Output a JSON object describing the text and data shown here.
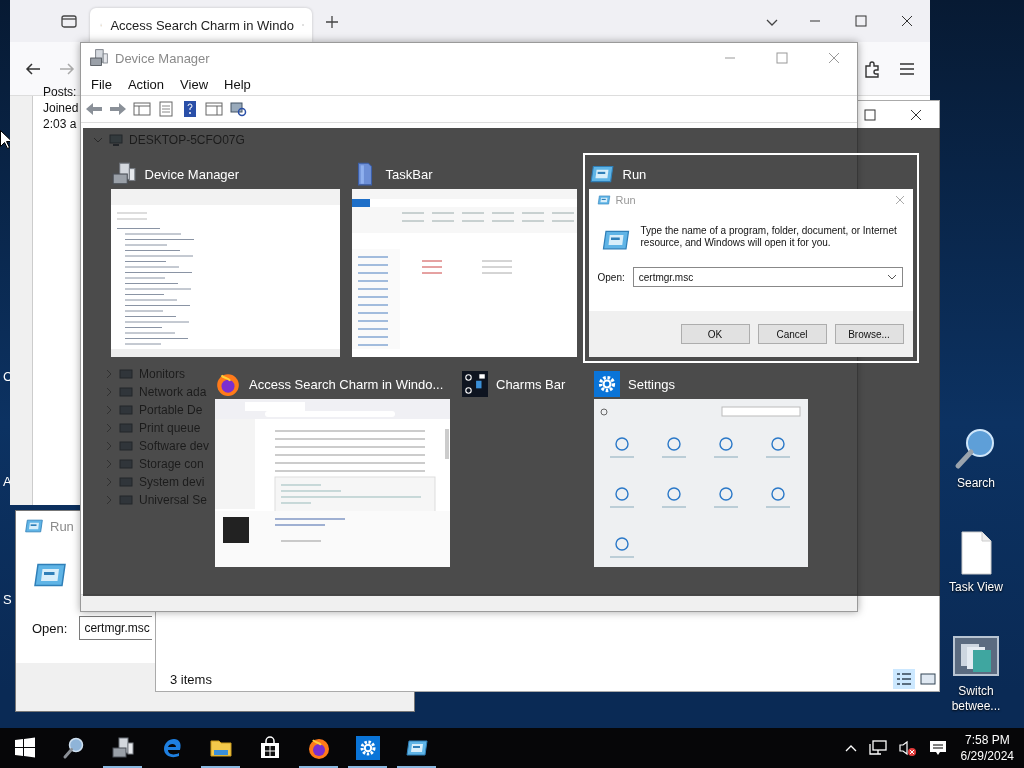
{
  "browser": {
    "tab_title": "Access Search Charm in Windo",
    "content_lines": [
      "Posts:",
      "Joined",
      "2:03 a"
    ]
  },
  "desktop_fragments": [
    "C",
    "A",
    "S"
  ],
  "explorer": {
    "status": "3 items"
  },
  "run_dialog": {
    "title": "Run",
    "open_label": "Open:",
    "value": "certmgr.msc"
  },
  "device_manager": {
    "title": "Device Manager",
    "menu": [
      "File",
      "Action",
      "View",
      "Help"
    ],
    "tree_root": "DESKTOP-5CFO07G",
    "tree_items": [
      "Monitors",
      "Network ada",
      "Portable De",
      "Print queue",
      "Software dev",
      "Storage con",
      "System devi",
      "Universal Se"
    ]
  },
  "switcher": {
    "windows": [
      {
        "title": "Device Manager",
        "kind": "device-manager",
        "selected": false
      },
      {
        "title": "TaskBar",
        "kind": "folder",
        "selected": false
      },
      {
        "title": "Run",
        "kind": "run",
        "selected": true,
        "preview": {
          "title": "Run",
          "message": "Type the name of a program, folder, document, or Internet resource, and Windows will open it for you.",
          "open_label": "Open:",
          "value": "certmgr.msc",
          "buttons": [
            "OK",
            "Cancel",
            "Browse..."
          ]
        }
      },
      {
        "title": "Access Search Charm in Windo...",
        "kind": "firefox",
        "selected": false
      },
      {
        "title": "Charms Bar",
        "kind": "charms",
        "selected": false
      },
      {
        "title": "Settings",
        "kind": "settings",
        "selected": false
      }
    ]
  },
  "desktop_icons": [
    {
      "label": "Search",
      "kind": "search"
    },
    {
      "label": "Task View",
      "kind": "document"
    },
    {
      "label": "Switch betwee...",
      "kind": "switch"
    }
  ],
  "taskbar": {
    "apps": [
      {
        "kind": "start",
        "running": false
      },
      {
        "kind": "search",
        "running": false
      },
      {
        "kind": "device-manager",
        "running": true
      },
      {
        "kind": "edge",
        "running": false
      },
      {
        "kind": "explorer",
        "running": true
      },
      {
        "kind": "store",
        "running": false
      },
      {
        "kind": "firefox",
        "running": true
      },
      {
        "kind": "settings",
        "running": true
      },
      {
        "kind": "run",
        "running": true
      }
    ],
    "time": "7:58 PM",
    "date": "6/29/2024"
  }
}
